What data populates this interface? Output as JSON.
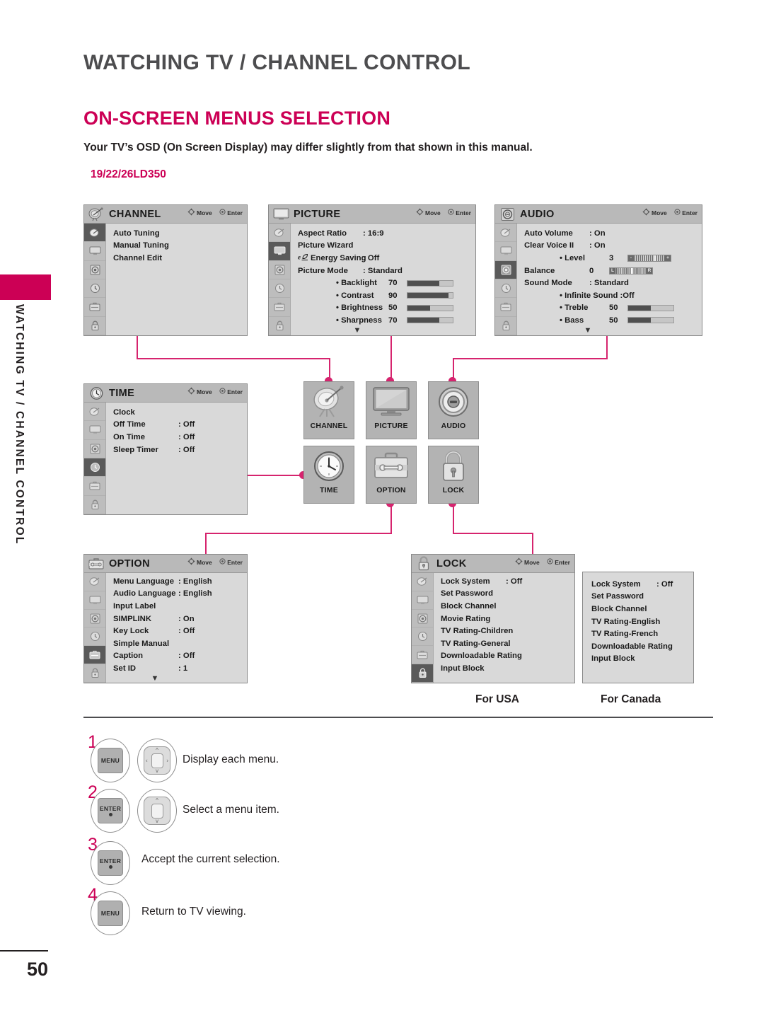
{
  "page": {
    "chapter_title": "WATCHING TV / CHANNEL CONTROL",
    "section_title": "ON-SCREEN MENUS SELECTION",
    "intro": "Your TV’s OSD (On Screen Display) may differ slightly from that shown in this manual.",
    "model": "19/22/26LD350",
    "side_tab_text": "WATCHING TV / CHANNEL CONTROL",
    "page_number": "50",
    "accent_color": "#cc0055",
    "connector_color": "#d6246e"
  },
  "osd_hint": {
    "move": "Move",
    "enter": "Enter"
  },
  "menus": {
    "channel": {
      "title": "CHANNEL",
      "selected_rail_index": 0,
      "rows": [
        {
          "label": "Auto Tuning",
          "value": ""
        },
        {
          "label": "Manual Tuning",
          "value": ""
        },
        {
          "label": "Channel Edit",
          "value": ""
        }
      ]
    },
    "picture": {
      "title": "PICTURE",
      "selected_rail_index": 1,
      "rows": [
        {
          "label": "Aspect Ratio",
          "value": ": 16:9"
        },
        {
          "label": "Picture Wizard",
          "value": ""
        },
        {
          "label": "Energy Saving",
          "value": ": Off",
          "icon": "eco-icon"
        },
        {
          "label": "Picture Mode",
          "value": ": Standard"
        }
      ],
      "sliders": [
        {
          "label": "• Backlight",
          "value": "70",
          "percent": 70
        },
        {
          "label": "• Contrast",
          "value": "90",
          "percent": 90
        },
        {
          "label": "• Brightness",
          "value": "50",
          "percent": 50
        },
        {
          "label": "• Sharpness",
          "value": "70",
          "percent": 70
        }
      ],
      "more_caret": "▼"
    },
    "audio": {
      "title": "AUDIO",
      "selected_rail_index": 2,
      "rows": [
        {
          "label": "Auto Volume",
          "value": ": On"
        },
        {
          "label": "Clear Voice II",
          "value": ": On"
        }
      ],
      "level": {
        "label": "• Level",
        "value": "3",
        "left_cap": "-",
        "right_cap": "+",
        "percent": 62
      },
      "balance": {
        "label": "Balance",
        "value": "0",
        "left_cap": "L",
        "right_cap": "R",
        "percent": 50
      },
      "sound_mode": {
        "label": "Sound Mode",
        "value": ": Standard"
      },
      "infinite": {
        "label": "• Infinite Sound :Off"
      },
      "sliders": [
        {
          "label": "• Treble",
          "value": "50",
          "percent": 50
        },
        {
          "label": "• Bass",
          "value": "50",
          "percent": 50
        }
      ],
      "more_caret": "▼"
    },
    "time": {
      "title": "TIME",
      "selected_rail_index": 3,
      "rows": [
        {
          "label": "Clock",
          "value": ""
        },
        {
          "label": "Off Time",
          "value": ": Off"
        },
        {
          "label": "On Time",
          "value": ": Off"
        },
        {
          "label": "Sleep Timer",
          "value": ": Off"
        }
      ]
    },
    "option": {
      "title": "OPTION",
      "selected_rail_index": 4,
      "rows": [
        {
          "label": "Menu Language",
          "value": ": English"
        },
        {
          "label": "Audio Language",
          "value": ": English"
        },
        {
          "label": "Input Label",
          "value": ""
        },
        {
          "label": "SIMPLINK",
          "value": ": On"
        },
        {
          "label": "Key Lock",
          "value": ": Off"
        },
        {
          "label": "Simple Manual",
          "value": ""
        },
        {
          "label": "Caption",
          "value": ": Off"
        },
        {
          "label": "Set ID",
          "value": ": 1"
        }
      ],
      "more_caret": "▼"
    },
    "lock_usa": {
      "title": "LOCK",
      "selected_rail_index": 5,
      "rows": [
        {
          "label": "Lock System",
          "value": ": Off"
        },
        {
          "label": "Set Password",
          "value": ""
        },
        {
          "label": "Block Channel",
          "value": ""
        },
        {
          "label": "Movie Rating",
          "value": ""
        },
        {
          "label": "TV Rating-Children",
          "value": ""
        },
        {
          "label": "TV Rating-General",
          "value": ""
        },
        {
          "label": "Downloadable Rating",
          "value": ""
        },
        {
          "label": "Input Block",
          "value": ""
        }
      ]
    },
    "lock_canada": {
      "rows": [
        {
          "label": "Lock System",
          "value": ": Off"
        },
        {
          "label": "Set Password",
          "value": ""
        },
        {
          "label": "Block Channel",
          "value": ""
        },
        {
          "label": "TV Rating-English",
          "value": ""
        },
        {
          "label": "TV Rating-French",
          "value": ""
        },
        {
          "label": "Downloadable Rating",
          "value": ""
        },
        {
          "label": "Input Block",
          "value": ""
        }
      ]
    }
  },
  "region_captions": {
    "usa": "For USA",
    "canada": "For Canada"
  },
  "icon_grid": [
    {
      "label": "CHANNEL",
      "icon": "satellite-dish-icon"
    },
    {
      "label": "PICTURE",
      "icon": "tv-screen-icon"
    },
    {
      "label": "AUDIO",
      "icon": "speaker-icon"
    },
    {
      "label": "TIME",
      "icon": "clock-icon"
    },
    {
      "label": "OPTION",
      "icon": "toolbox-icon"
    },
    {
      "label": "LOCK",
      "icon": "padlock-icon"
    }
  ],
  "steps": [
    {
      "num": "1",
      "keys": [
        "MENU",
        "nav4"
      ],
      "text": "Display each menu."
    },
    {
      "num": "2",
      "keys": [
        "ENTER",
        "nav2"
      ],
      "text": "Select a menu item."
    },
    {
      "num": "3",
      "keys": [
        "ENTER"
      ],
      "text": "Accept the current selection."
    },
    {
      "num": "4",
      "keys": [
        "MENU"
      ],
      "text": "Return to TV viewing."
    }
  ],
  "key_labels": {
    "menu": "MENU",
    "enter": "ENTER"
  }
}
